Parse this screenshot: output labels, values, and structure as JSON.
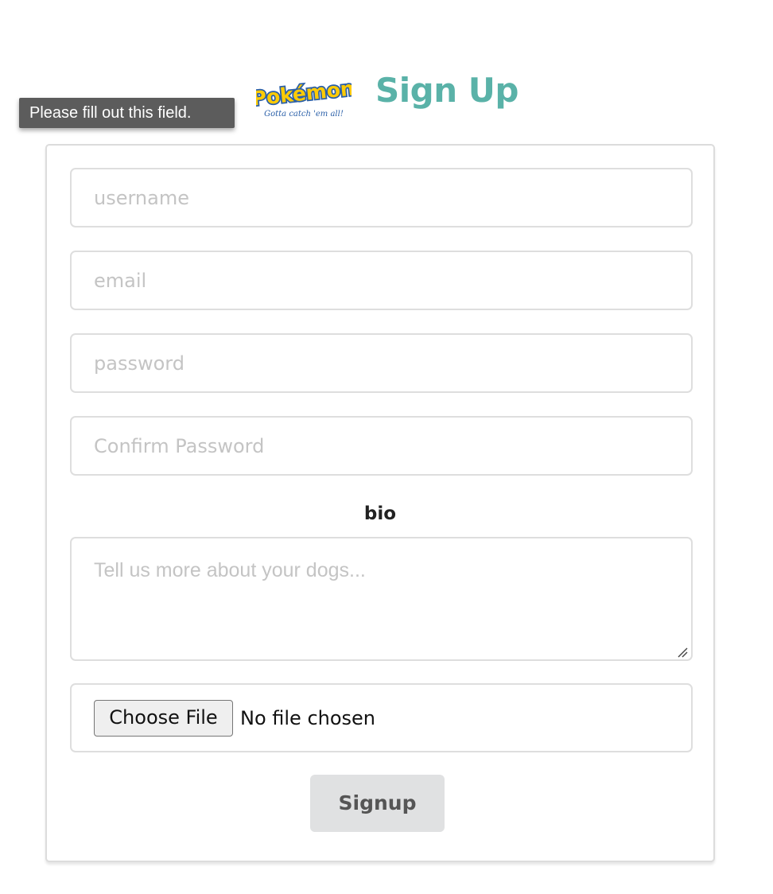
{
  "tooltip": {
    "text": "Please fill out this field."
  },
  "header": {
    "logo_icon": "pokemon-logo-icon",
    "logo_text": "Pokémon",
    "logo_tagline": "Gotta catch 'em all!",
    "title": "Sign Up"
  },
  "form": {
    "username": {
      "placeholder": "username",
      "value": ""
    },
    "email": {
      "placeholder": "email",
      "value": ""
    },
    "password": {
      "placeholder": "password",
      "value": ""
    },
    "confirm_password": {
      "placeholder": "Confirm Password",
      "value": ""
    },
    "bio_label": "bio",
    "bio": {
      "placeholder": "Tell us more about your dogs...",
      "value": ""
    },
    "file": {
      "button_label": "Choose File",
      "status": "No file chosen"
    },
    "submit_label": "Signup"
  },
  "colors": {
    "title": "#5ab2a8",
    "tooltip_bg": "#5c5c5c",
    "button_bg": "#e0e1e2",
    "border": "#dedede"
  }
}
